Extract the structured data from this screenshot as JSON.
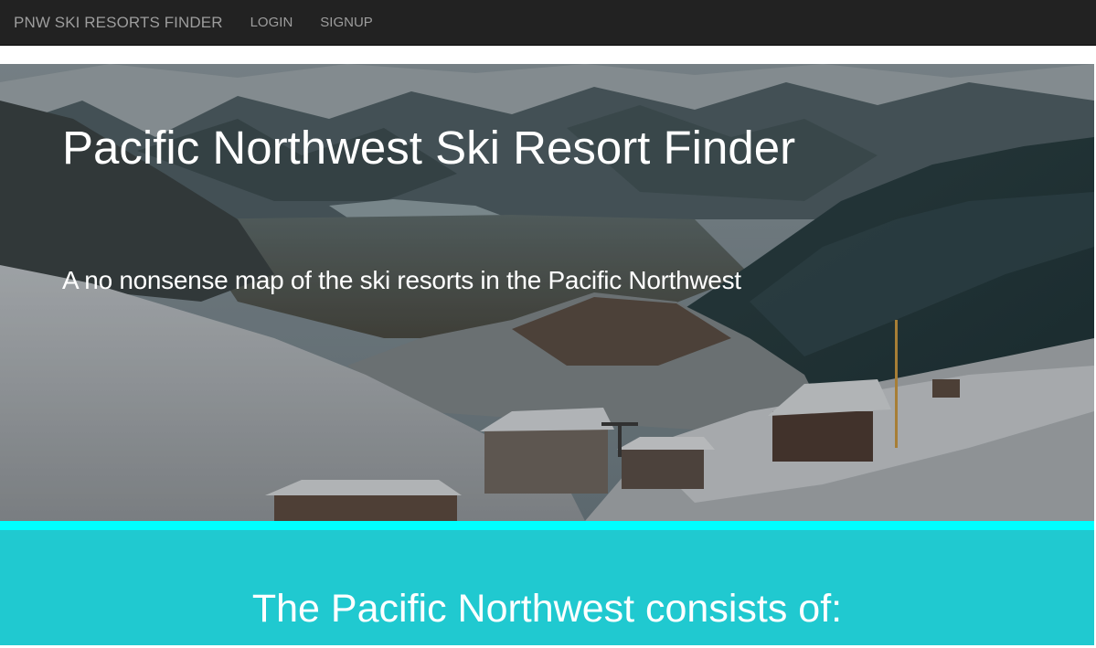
{
  "navbar": {
    "brand": "PNW SKI RESORTS FINDER",
    "links": [
      {
        "label": "LOGIN"
      },
      {
        "label": "SIGNUP"
      }
    ]
  },
  "hero": {
    "title": "Pacific Northwest Ski Resort Finder",
    "subtitle": "A no nonsense map of the ski resorts in the Pacific Northwest"
  },
  "section": {
    "heading": "The Pacific Northwest consists of:"
  },
  "colors": {
    "navbar_bg": "#222222",
    "nav_text": "#9d9d9d",
    "accent_bar": "#00ffff",
    "section_bg": "#20c9d0",
    "hero_text": "#ffffff"
  }
}
